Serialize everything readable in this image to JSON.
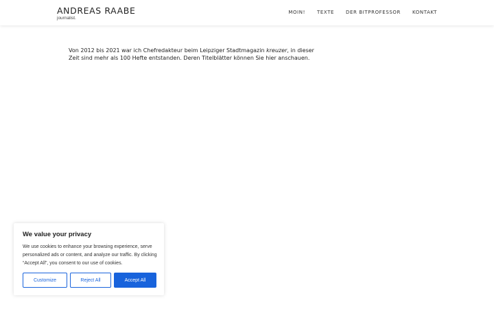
{
  "header": {
    "title": "ANDREAS RAABE",
    "tagline": "journalist."
  },
  "nav": {
    "items": [
      "MOIN!",
      "TEXTE",
      "DER BITPROFESSOR",
      "KONTAKT"
    ]
  },
  "intro": {
    "part1": "Von 2012 bis 2021 war ich Chefredakteur beim Leipziger Stadtmagazin ",
    "emphasis": "kreuzer",
    "part2": ", in dieser Zeit sind mehr als 100 Hefte entstanden. Deren Titelblätter können Sie hier anschauen."
  },
  "cookie": {
    "title": "We value your privacy",
    "text": "We use cookies to enhance your browsing experience, serve personalized ads or content, and analyze our traffic. By clicking “Accept All”, you consent to our use of cookies.",
    "customize_label": "Customize",
    "reject_label": "Reject All",
    "accept_label": "Accept All"
  },
  "colors": {
    "accent": "#1863dc",
    "text": "#333333"
  }
}
